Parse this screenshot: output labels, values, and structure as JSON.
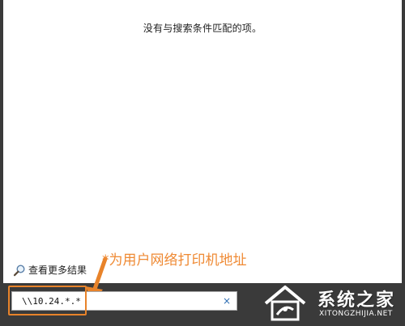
{
  "results": {
    "no_results_message": "没有与搜索条件匹配的项。",
    "see_more_label": "查看更多结果"
  },
  "search": {
    "value": "\\\\10.24.*.*",
    "clear_icon": "×"
  },
  "annotation": {
    "text": "*为用户网络打印机地址",
    "color": "#ef8a34"
  },
  "icons": {
    "see_more": "magnifier-icon",
    "clear": "close-icon"
  },
  "watermark": {
    "title": "系统之家",
    "url": "XITONGZHIJIA.NET"
  }
}
